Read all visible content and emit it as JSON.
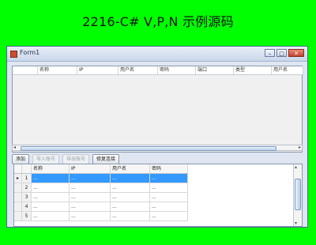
{
  "banner": {
    "title": "2216-C# V,P,N 示例源码"
  },
  "window": {
    "title": "Form1",
    "buttons": {
      "min": "–",
      "max": "□",
      "close": "✕"
    }
  },
  "grid_top": {
    "columns": [
      "",
      "名称",
      "IP",
      "用户名",
      "密码",
      "端口",
      "类型",
      "用户名"
    ]
  },
  "toolbar": {
    "buttons": [
      {
        "label": "添加",
        "enabled": true
      },
      {
        "label": "导入账号",
        "enabled": false
      },
      {
        "label": "导出账号",
        "enabled": false
      },
      {
        "label": "修复连接",
        "enabled": true
      }
    ]
  },
  "grid_bottom": {
    "columns": [
      "名称",
      "IP",
      "用户名",
      "密码"
    ],
    "rows": [
      {
        "indicator": "▸",
        "no": "1",
        "name": "...",
        "ip": "...",
        "user": "...",
        "pass": "...",
        "selected": true
      },
      {
        "indicator": "",
        "no": "2",
        "name": "...",
        "ip": "...",
        "user": "...",
        "pass": "...",
        "selected": false
      },
      {
        "indicator": "",
        "no": "3",
        "name": "...",
        "ip": "...",
        "user": "...",
        "pass": "...",
        "selected": false
      },
      {
        "indicator": "",
        "no": "4",
        "name": "...",
        "ip": "...",
        "user": "...",
        "pass": "...",
        "selected": false
      },
      {
        "indicator": "",
        "no": "5",
        "name": "...",
        "ip": "...",
        "user": "...",
        "pass": "...",
        "selected": false
      }
    ]
  },
  "colors": {
    "background": "#00ff00",
    "selection": "#3399ff"
  }
}
